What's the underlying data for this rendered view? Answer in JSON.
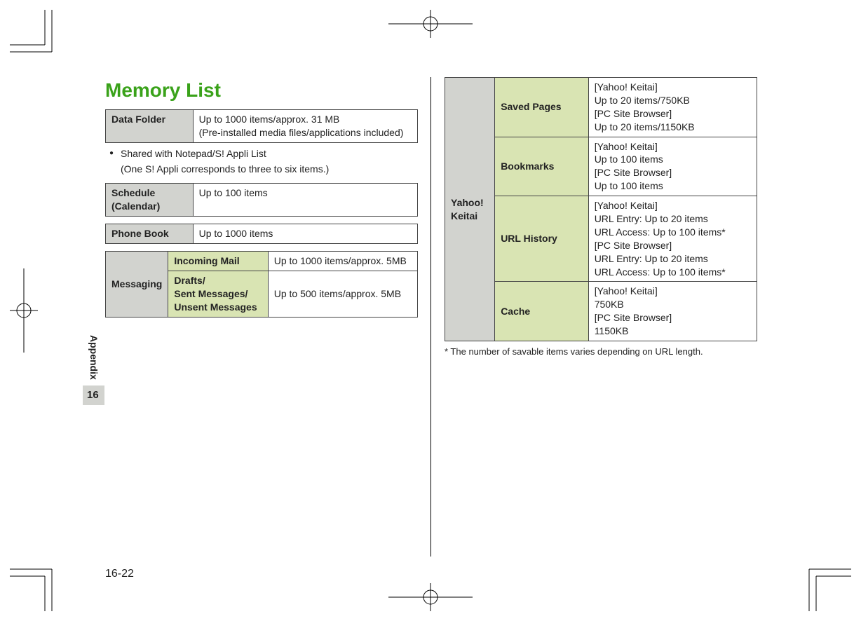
{
  "title": "Memory List",
  "sidebar": {
    "label": "Appendix",
    "chapter": "16"
  },
  "page_number": "16-22",
  "data_folder": {
    "label": "Data Folder",
    "value_line1": "Up to 1000 items/approx. 31 MB",
    "value_line2": "(Pre-installed media files/applications included)"
  },
  "shared_note_line1": "Shared with Notepad/S! Appli List",
  "shared_note_line2": "(One S! Appli corresponds to three to six items.)",
  "schedule": {
    "label": "Schedule\n(Calendar)",
    "value": "Up to 100 items"
  },
  "phonebook": {
    "label": "Phone Book",
    "value": "Up to 1000 items"
  },
  "messaging": {
    "group_label": "Messaging",
    "incoming_label": "Incoming Mail",
    "incoming_value": "Up to 1000 items/approx. 5MB",
    "drafts_label": "Drafts/\nSent Messages/\nUnsent Messages",
    "drafts_value": "Up to 500 items/approx. 5MB"
  },
  "yahoo": {
    "group_label": "Yahoo!\nKeitai",
    "saved_pages_label": "Saved Pages",
    "saved_pages_value": "[Yahoo! Keitai]\nUp to 20 items/750KB\n[PC Site Browser]\nUp to 20 items/1150KB",
    "bookmarks_label": "Bookmarks",
    "bookmarks_value": "[Yahoo! Keitai]\nUp to 100 items\n[PC Site Browser]\nUp to 100 items",
    "url_history_label": "URL History",
    "url_history_value": "[Yahoo! Keitai]\nURL Entry: Up to 20 items\nURL Access: Up to 100 items*\n[PC Site Browser]\nURL Entry: Up to 20 items\nURL Access: Up to 100 items*",
    "cache_label": "Cache",
    "cache_value": "[Yahoo! Keitai]\n750KB\n[PC Site Browser]\n1150KB"
  },
  "footnote": "* The number of savable items varies depending on URL length."
}
